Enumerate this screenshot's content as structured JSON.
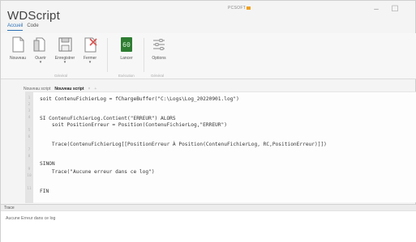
{
  "app": {
    "title": "WDScript",
    "brand": "PCSOFT",
    "window_controls": {
      "minimize": "–",
      "maximize": "☐"
    }
  },
  "menu": {
    "tabs": [
      {
        "label": "Accueil",
        "active": true
      },
      {
        "label": "Code",
        "active": false
      }
    ]
  },
  "ribbon": {
    "buttons": [
      {
        "label": "Nouveau",
        "icon": "new-file-icon"
      },
      {
        "label": "Ouvrir",
        "icon": "open-folder-icon"
      },
      {
        "label": "Enregistrer",
        "icon": "save-icon"
      },
      {
        "label": "Fermer",
        "icon": "close-file-icon"
      },
      {
        "label": "Lancer",
        "icon": "run-icon"
      },
      {
        "label": "Options",
        "icon": "options-icon"
      }
    ],
    "groups": [
      "Général",
      "Exécution",
      "Général"
    ]
  },
  "doc_tabs": [
    {
      "label": "Nouveau script",
      "active": false
    },
    {
      "label": "Nouveau script",
      "active": true
    }
  ],
  "editor": {
    "line_numbers": [
      "1",
      "2",
      "3",
      "4",
      "5",
      "6",
      "7",
      "8",
      "9",
      "10",
      "11"
    ],
    "lines": [
      "soit ContenuFichierLog = fChargeBuffer(\"C:\\Logs\\Log_20220901.log\")",
      "",
      "SI ContenuFichierLog.Contient(\"ERREUR\") ALORS",
      "    soit PositionErreur = Position(ContenuFichierLog,\"ERREUR\")",
      "",
      "    Trace(ContenuFichierLog[[PositionErreur À Position(ContenuFichierLog, RC,PositionErreur)]])",
      "",
      "SINON",
      "    Trace(\"Aucune erreur dans ce log\")",
      "",
      "FIN"
    ]
  },
  "trace": {
    "title": "Trace",
    "output": "Aucune Erreur dans ce log"
  },
  "colors": {
    "accent": "#2a6fb5",
    "run_button": "#2e7d32",
    "close_x": "#d9534f"
  }
}
